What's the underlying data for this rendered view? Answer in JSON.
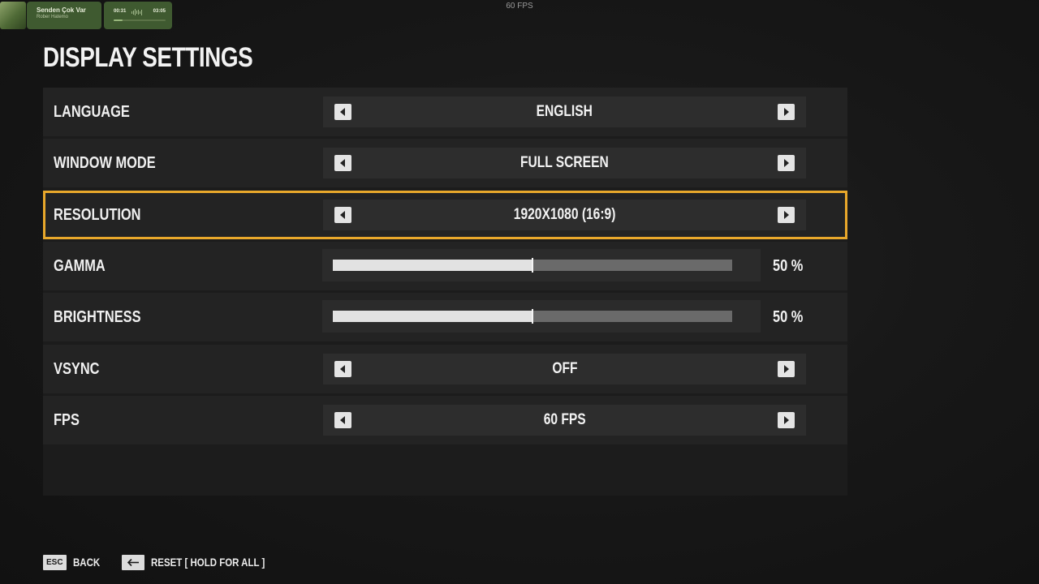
{
  "music_widget": {
    "track_title": "Senden Çok Var",
    "artist": "Rober Hatemo",
    "elapsed": "00:31",
    "duration": "03:05",
    "progress": 0.17,
    "cover_icon": "album-art-icon"
  },
  "fps_counter": "60 FPS",
  "page_title": "DISPLAY SETTINGS",
  "settings": [
    {
      "label": "LANGUAGE",
      "type": "selector",
      "value": "ENGLISH",
      "selected": false
    },
    {
      "label": "WINDOW MODE",
      "type": "selector",
      "value": "FULL SCREEN",
      "selected": false
    },
    {
      "label": "RESOLUTION",
      "type": "selector",
      "value": "1920X1080 (16:9)",
      "selected": true
    },
    {
      "label": "GAMMA",
      "type": "slider",
      "percent": 50,
      "value_text": "50 %",
      "selected": false
    },
    {
      "label": "BRIGHTNESS",
      "type": "slider",
      "percent": 50,
      "value_text": "50 %",
      "selected": false
    },
    {
      "label": "VSYNC",
      "type": "selector",
      "value": "OFF",
      "selected": false
    },
    {
      "label": "FPS",
      "type": "selector",
      "value": "60 FPS",
      "selected": false
    }
  ],
  "footer": {
    "back_key": "ESC",
    "back_label": "BACK",
    "reset_key_icon": "arrow-left-icon",
    "reset_label": "RESET [ HOLD FOR ALL ]"
  },
  "colors": {
    "selected_border": "#e9a82b",
    "widget_green": "#3f5a30"
  }
}
